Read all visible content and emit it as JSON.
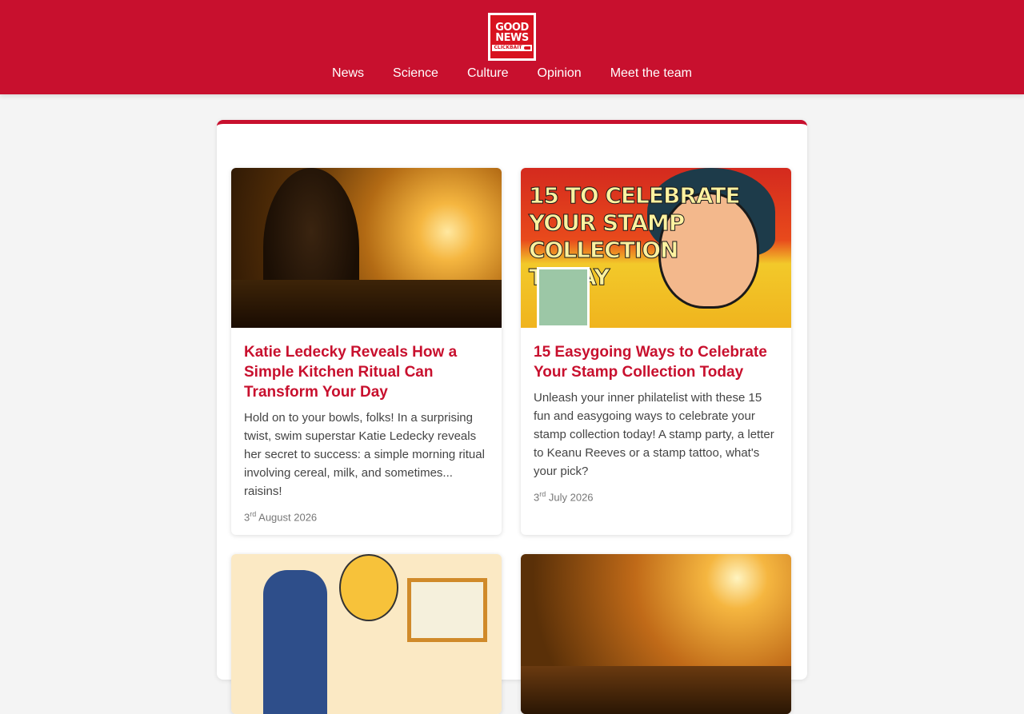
{
  "site": {
    "logo_line1": "GOOD",
    "logo_line2": "NEWS",
    "logo_tag": "CLICKBAIT"
  },
  "nav": [
    {
      "label": "News"
    },
    {
      "label": "Science"
    },
    {
      "label": "Culture"
    },
    {
      "label": "Opinion"
    },
    {
      "label": "Meet the team"
    }
  ],
  "articles": [
    {
      "title": "Katie Ledecky Reveals How a Simple Kitchen Ritual Can Transform Your Day",
      "summary": "Hold on to your bowls, folks! In a surprising twist, swim superstar Katie Ledecky reveals her secret to success: a simple morning ritual involving cereal, milk, and sometimes... raisins!",
      "date_day": "3",
      "date_suffix": "rd",
      "date_rest": "August 2026"
    },
    {
      "title": "15 Easygoing Ways to Celebrate Your Stamp Collection Today",
      "summary": "Unleash your inner philatelist with these 15 fun and easygoing ways to celebrate your stamp collection today! A stamp party, a letter to Keanu Reeves or a stamp tattoo, what's your pick?",
      "date_day": "3",
      "date_suffix": "rd",
      "date_rest": "July 2026"
    }
  ],
  "image_text": {
    "popart_headline": "15 TO CELEBRATE\nYOUR STAMP\nCOLLECTION\nTODAY"
  },
  "colors": {
    "brand": "#c8102e",
    "background": "#f4f4f4"
  }
}
